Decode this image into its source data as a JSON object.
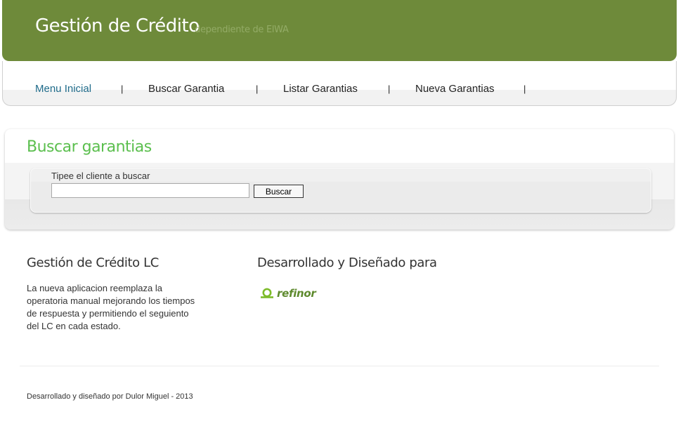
{
  "header": {
    "title": "Gestión de Crédito",
    "subtitle": "dependiente de ElWA",
    "color": "#6e8a3a"
  },
  "nav": {
    "items": [
      {
        "label": "Menu Inicial",
        "active": true
      },
      {
        "label": "Buscar Garantia",
        "active": false
      },
      {
        "label": "Listar Garantias",
        "active": false
      },
      {
        "label": "Nueva Garantias",
        "active": false
      }
    ],
    "separator": "|",
    "active_color": "#1f6b8a"
  },
  "search": {
    "heading": "Buscar garantias",
    "label": "Tipee el cliente a buscar",
    "input_value": "",
    "button_label": "Buscar",
    "heading_color": "#5bbf4e"
  },
  "info": {
    "left_title": "Gestión de Crédito LC",
    "left_text": "La nueva aplicacion reemplaza la operatoria manual mejorando los tiempos de respuesta y permitiendo el seguiento del LC en cada estado.",
    "right_title": "Desarrollado y Diseñado para",
    "logo_text": "refinor",
    "logo_icon": "refinor-logo-icon"
  },
  "footer": {
    "credits": "Desarrollado y diseñado por Dulor Miguel - 2013"
  }
}
